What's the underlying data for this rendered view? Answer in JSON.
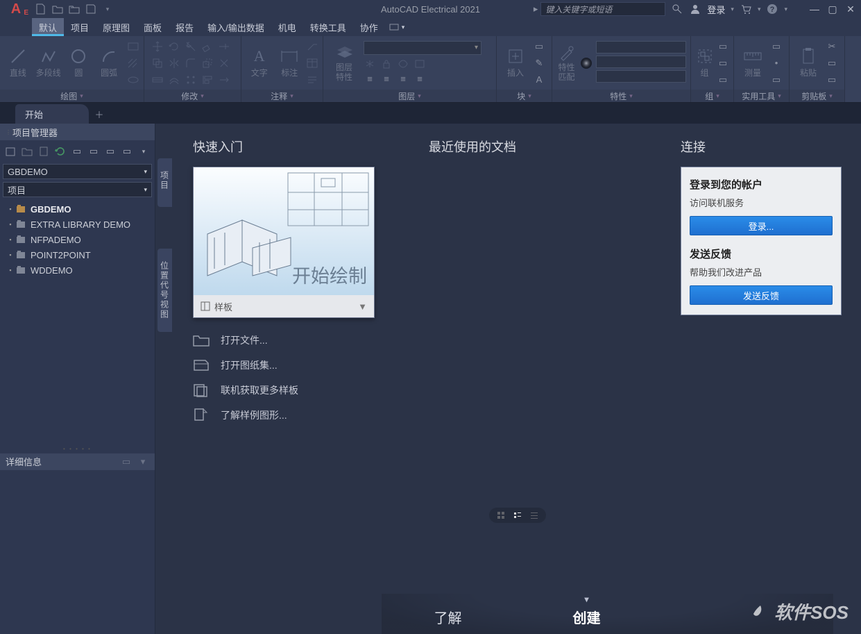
{
  "titlebar": {
    "app_title": "AutoCAD Electrical 2021",
    "search_placeholder": "键入关键字或短语",
    "login": "登录"
  },
  "menu": {
    "items": [
      "默认",
      "项目",
      "原理图",
      "面板",
      "报告",
      "输入/输出数据",
      "机电",
      "转换工具",
      "协作"
    ],
    "active_index": 0
  },
  "ribbon": {
    "panels": {
      "draw": {
        "title": "绘图",
        "line": "直线",
        "polyline": "多段线",
        "circle": "圆",
        "arc": "圆弧"
      },
      "modify": {
        "title": "修改"
      },
      "annotate": {
        "title": "注释",
        "text": "文字",
        "dim": "标注"
      },
      "layers": {
        "title": "图层",
        "props": "图层\n特性"
      },
      "block": {
        "title": "块",
        "insert": "插入"
      },
      "props": {
        "title": "特性",
        "match": "特性\n匹配"
      },
      "group": {
        "title": "组",
        "group": "组"
      },
      "utils": {
        "title": "实用工具",
        "measure": "测量"
      },
      "clip": {
        "title": "剪贴板",
        "paste": "粘贴"
      }
    }
  },
  "tabs": {
    "start": "开始"
  },
  "pm": {
    "title": "项目管理器",
    "combo1": "GBDEMO",
    "combo2": "项目",
    "tree": [
      {
        "label": "GBDEMO",
        "bold": true
      },
      {
        "label": "EXTRA LIBRARY DEMO"
      },
      {
        "label": "NFPADEMO"
      },
      {
        "label": "POINT2POINT"
      },
      {
        "label": "WDDEMO"
      }
    ],
    "details": "详细信息"
  },
  "side_tabs": {
    "projects": "项目",
    "locations": "位置代号视图"
  },
  "start": {
    "quick": "快速入门",
    "recent": "最近使用的文档",
    "connect": "连接",
    "card_text": "开始绘制",
    "card_footer": "样板",
    "links": [
      "打开文件...",
      "打开图纸集...",
      "联机获取更多样板",
      "了解样例图形..."
    ],
    "account_h": "登录到您的帐户",
    "account_p": "访问联机服务",
    "signin_btn": "登录...",
    "feedback_h": "发送反馈",
    "feedback_p": "帮助我们改进产品",
    "feedback_btn": "发送反馈"
  },
  "bottom": {
    "learn": "了解",
    "create": "创建"
  },
  "watermark": "软件SOS"
}
